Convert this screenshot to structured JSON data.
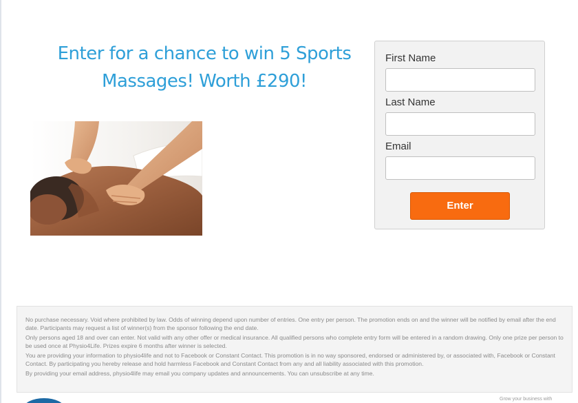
{
  "headline": {
    "line1": "Enter for a chance to win 5 Sports",
    "line2": "Massages! Worth £290!"
  },
  "photo": {
    "icon": "massage-photo"
  },
  "form": {
    "first_name_label": "First Name",
    "first_name_value": "",
    "last_name_label": "Last Name",
    "last_name_value": "",
    "email_label": "Email",
    "email_value": "",
    "submit_label": "Enter"
  },
  "terms": [
    "No purchase necessary. Void where prohibited by law. Odds of winning depend upon number of entries. One entry per person. The promotion ends on and the winner will be notified by email after the end date. Participants may request a list of winner(s) from the sponsor following the end date.",
    "Only persons aged 18 and over can enter. Not valid with any other offer or medical insurance. All qualified persons who complete entry form will be entered in a random drawing. Only one prize per person to be used once at Physio4Life. Prizes expire 6 months after winner is selected.",
    "You are providing your information to physio4life and not to Facebook or Constant Contact. This promotion is in no way sponsored, endorsed or administered by, or associated with, Facebook or Constant Contact. By participating you hereby release and hold harmless Facebook and Constant Contact from any and all liability associated with this promotion.",
    "By providing your email address, physio4life may email you company updates and announcements. You can unsubscribe at any time."
  ],
  "footer": {
    "note": "Grow your business with"
  },
  "colors": {
    "headline": "#2e9fd8",
    "button": "#f86b10",
    "panel": "#f2f2f2"
  }
}
